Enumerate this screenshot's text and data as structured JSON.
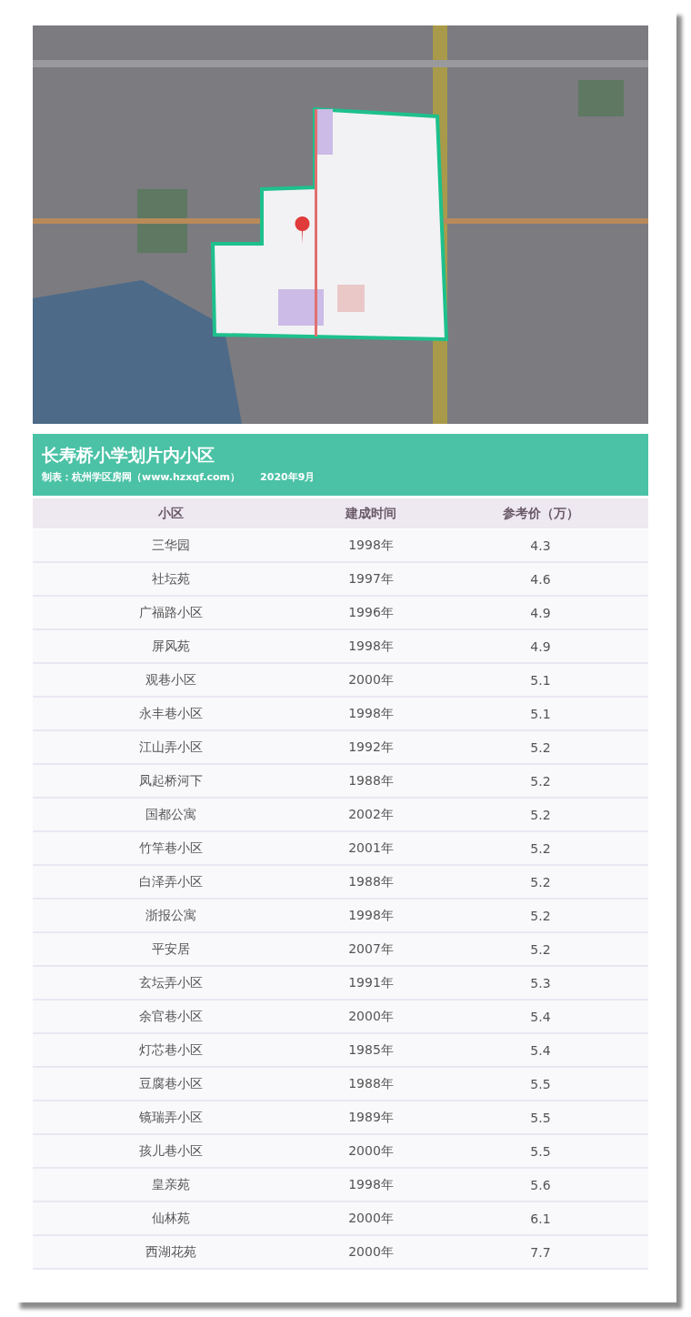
{
  "header": {
    "title": "长寿桥小学划片内小区",
    "credit": "制表：杭州学区房网（www.hzxqf.com）",
    "date": "2020年9月"
  },
  "table": {
    "columns": [
      "小区",
      "建成时间",
      "参考价（万）"
    ],
    "rows": [
      [
        "三华园",
        "1998年",
        "4.3"
      ],
      [
        "社坛苑",
        "1997年",
        "4.6"
      ],
      [
        "广福路小区",
        "1996年",
        "4.9"
      ],
      [
        "屏风苑",
        "1998年",
        "4.9"
      ],
      [
        "观巷小区",
        "2000年",
        "5.1"
      ],
      [
        "永丰巷小区",
        "1998年",
        "5.1"
      ],
      [
        "江山弄小区",
        "1992年",
        "5.2"
      ],
      [
        "凤起桥河下",
        "1988年",
        "5.2"
      ],
      [
        "国都公寓",
        "2002年",
        "5.2"
      ],
      [
        "竹竿巷小区",
        "2001年",
        "5.2"
      ],
      [
        "白泽弄小区",
        "1988年",
        "5.2"
      ],
      [
        "浙报公寓",
        "1998年",
        "5.2"
      ],
      [
        "平安居",
        "2007年",
        "5.2"
      ],
      [
        "玄坛弄小区",
        "1991年",
        "5.3"
      ],
      [
        "余官巷小区",
        "2000年",
        "5.4"
      ],
      [
        "灯芯巷小区",
        "1985年",
        "5.4"
      ],
      [
        "豆腐巷小区",
        "1988年",
        "5.5"
      ],
      [
        "镜瑞弄小区",
        "1989年",
        "5.5"
      ],
      [
        "孩儿巷小区",
        "2000年",
        "5.5"
      ],
      [
        "皇亲苑",
        "1998年",
        "5.6"
      ],
      [
        "仙林苑",
        "2000年",
        "6.1"
      ],
      [
        "西湖花苑",
        "2000年",
        "7.7"
      ]
    ]
  }
}
